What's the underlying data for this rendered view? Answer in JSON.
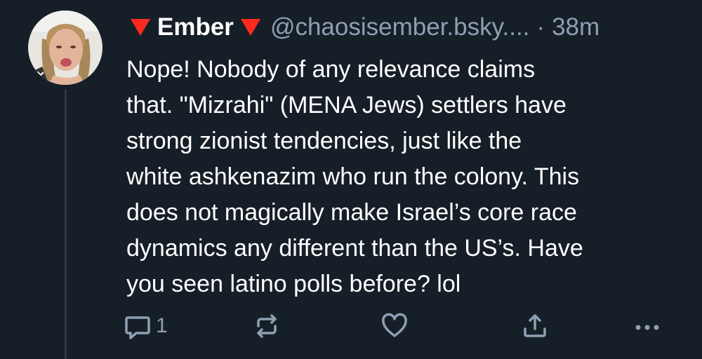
{
  "post": {
    "display_name": "Ember",
    "handle": "@chaosisember.bsky....",
    "separator": "·",
    "timestamp": "38m",
    "text": "Nope! Nobody of any relevance claims\nthat. \"Mizrahi\" (MENA Jews) settlers have\nstrong zionist tendencies, just like the\nwhite ashkenazim who run the colony. This\ndoes not magically make Israel’s core race\ndynamics any different than the US’s. Have\nyou seen latino polls before? lol"
  },
  "actions": {
    "reply_icon": "reply-icon",
    "reply_count": "1",
    "repost_icon": "repost-icon",
    "like_icon": "heart-icon",
    "share_icon": "share-icon",
    "more_icon": "more-icon"
  },
  "colors": {
    "background": "#161e27",
    "muted": "#8ea0b3",
    "flag_red": "#ff2a1f"
  }
}
